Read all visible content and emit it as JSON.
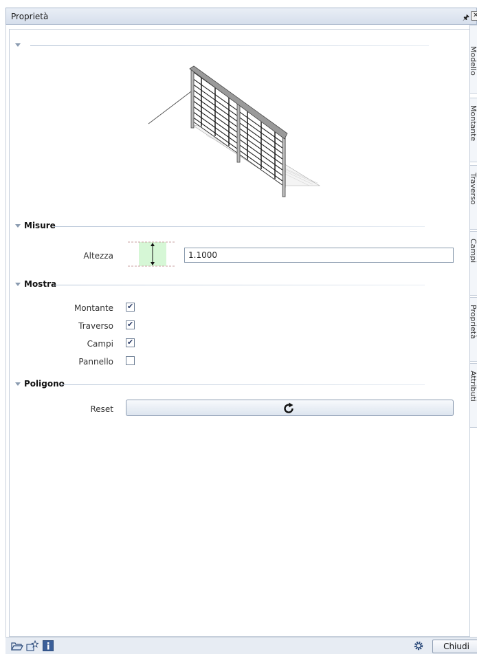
{
  "window": {
    "title": "Proprietà",
    "pin_glyph": " ᵖ",
    "close_glyph": "✕"
  },
  "side_tabs": [
    "Modello",
    "Montante",
    "Traverso",
    "Campi",
    "Proprietà",
    "Attributi"
  ],
  "sections": {
    "misure": {
      "label": "Misure",
      "altezza_label": "Altezza",
      "altezza_value": "1.1000"
    },
    "mostra": {
      "label": "Mostra",
      "items": [
        {
          "label": "Montante",
          "checked": true
        },
        {
          "label": "Traverso",
          "checked": true
        },
        {
          "label": "Campi",
          "checked": true
        },
        {
          "label": "Pannello",
          "checked": false
        }
      ]
    },
    "poligono": {
      "label": "Poligono",
      "reset_label": "Reset"
    }
  },
  "statusbar": {
    "close_label": "Chiudi",
    "icons": [
      "open-folder-icon",
      "favorites-icon",
      "info-icon",
      "settings-icon"
    ]
  }
}
